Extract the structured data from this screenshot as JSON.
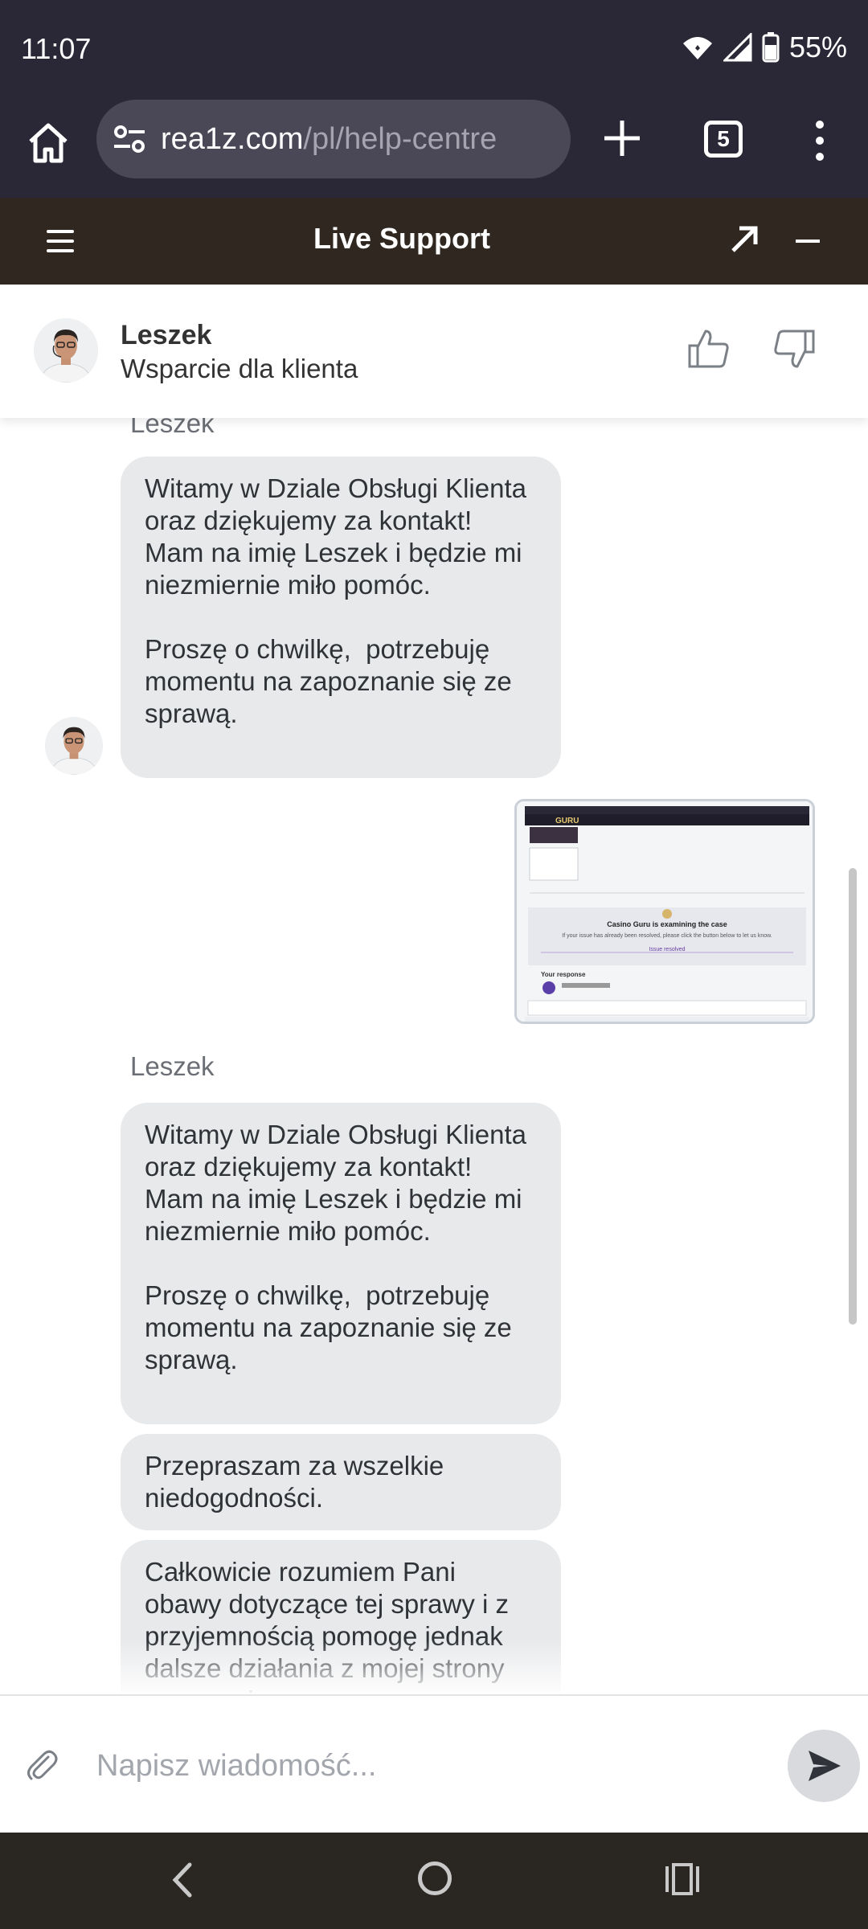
{
  "status_bar": {
    "time": "11:07",
    "battery": "55%"
  },
  "browser": {
    "url_host": "rea1z.com",
    "url_path": "/pl/help-centre",
    "tab_count": "5"
  },
  "widget": {
    "title": "Live Support"
  },
  "agent": {
    "name": "Leszek",
    "role": "Wsparcie dla klienta"
  },
  "messages": {
    "sender_1": "Leszek",
    "bubble_1": "Witamy w Dziale Obsługi Klienta oraz dziękujemy za kontakt!\nMam na imię Leszek i będzie mi niezmiernie miło pomóc.\n\nProszę o chwilkę,  potrzebuję momentu na zapoznanie się ze sprawą.",
    "sender_2": "Leszek",
    "bubble_2": "Witamy w Dziale Obsługi Klienta oraz dziękujemy za kontakt!\nMam na imię Leszek i będzie mi niezmiernie miło pomóc.\n\nProszę o chwilkę,  potrzebuję momentu na zapoznanie się ze sprawą.",
    "bubble_3": "Przepraszam za wszelkie niedogodności.",
    "bubble_4": "Całkowicie rozumiem Pani obawy dotyczące tej sprawy i z przyjemnością pomogę jednak dalsze działania z mojej strony są ograniczone"
  },
  "attachment": {
    "brand": "GURU",
    "line_1": "Casino Guru is examining the case",
    "line_2": "If your issue has already been resolved, please click the button below to let us know.",
    "button": "Issue resolved",
    "response_label": "Your response"
  },
  "composer": {
    "placeholder": "Napisz wiadomość..."
  }
}
